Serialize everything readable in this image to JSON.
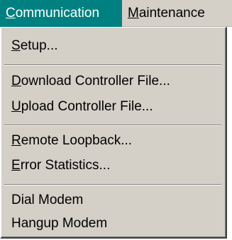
{
  "menubar": {
    "items": [
      {
        "label": "Communication",
        "accesskey_first": "C",
        "rest": "ommunication"
      },
      {
        "label": "Maintenance",
        "accesskey_first": "M",
        "rest": "aintenance"
      }
    ]
  },
  "dropdown": {
    "items": [
      {
        "label": "Setup...",
        "first": "S",
        "rest": "etup..."
      },
      {
        "label": "Download Controller File...",
        "first": "D",
        "rest": "ownload Controller File..."
      },
      {
        "label": "Upload Controller File...",
        "first": "U",
        "rest": "pload Controller File..."
      },
      {
        "label": "Remote Loopback...",
        "first": "R",
        "rest": "emote Loopback..."
      },
      {
        "label": "Error Statistics...",
        "first": "E",
        "rest": "rror Statistics..."
      },
      {
        "label": "Dial Modem"
      },
      {
        "label": "Hangup Modem"
      }
    ]
  },
  "colors": {
    "menu_bg": "#d4d0c8",
    "highlight": "#008080",
    "highlight_text": "#ffffff"
  }
}
